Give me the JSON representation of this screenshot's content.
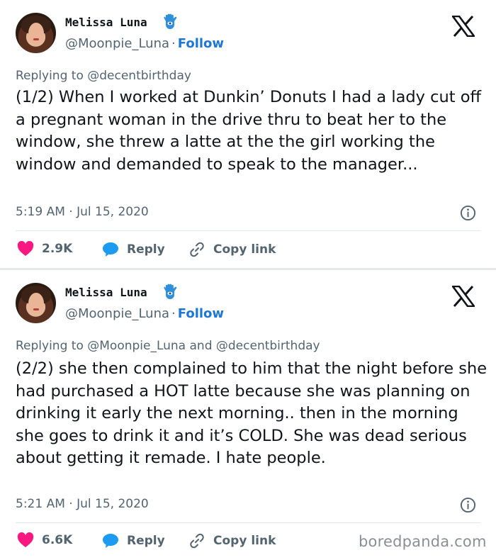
{
  "tweets": [
    {
      "author_name": "Melissa Luna",
      "handle": "@Moonpie_Luna",
      "separator": "·",
      "follow_label": "Follow",
      "replying_to": "Replying to @decentbirthday",
      "text": "(1/2) When I worked at Dunkin’ Donuts I had a lady cut off a pregnant woman in the drive thru to beat her to the window, she threw a latte at the the girl working the window and demanded to speak to the manager...",
      "timestamp": "5:19 AM · Jul 15, 2020",
      "likes": "2.9K",
      "reply_label": "Reply",
      "copy_link_label": "Copy link"
    },
    {
      "author_name": "Melissa Luna",
      "handle": "@Moonpie_Luna",
      "separator": "·",
      "follow_label": "Follow",
      "replying_to": "Replying to @Moonpie_Luna and @decentbirthday",
      "text": "(2/2) she then complained to him that the night before she had purchased a HOT latte because she was planning on drinking it early the next morning.. then in the morning she goes to drink it and it’s COLD. She was dead serious about getting it remade. I hate people.",
      "timestamp": "5:21 AM · Jul 15, 2020",
      "likes": "6.6K",
      "reply_label": "Reply",
      "copy_link_label": "Copy link"
    }
  ],
  "icons": {
    "brand": "x-logo-icon",
    "badge": "hamsa-emoji-icon",
    "like": "heart-icon",
    "reply": "speech-bubble-icon",
    "copy": "link-icon",
    "info": "info-icon"
  },
  "colors": {
    "like": "#f91880",
    "reply": "#1d9bf0",
    "follow": "#1d77d3",
    "muted": "#536471"
  },
  "watermark": "boredpanda.com"
}
